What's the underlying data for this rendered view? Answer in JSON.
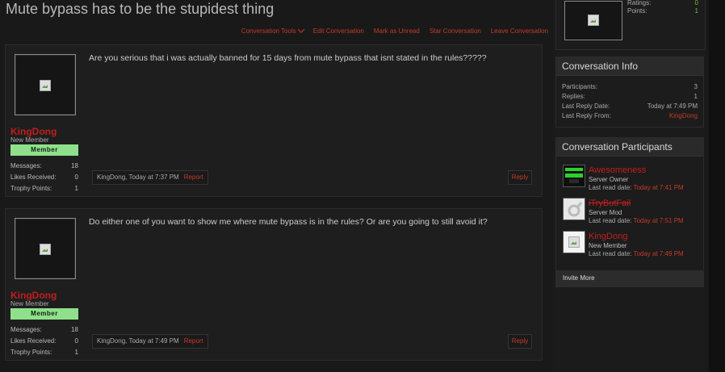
{
  "title": "Mute bypass has to be the stupidest thing",
  "tools": {
    "conversation_tools": "Conversation Tools",
    "edit": "Edit Conversation",
    "mark_unread": "Mark as Unread",
    "star": "Star Conversation",
    "leave": "Leave Conversation"
  },
  "messages": [
    {
      "username": "KingDong",
      "role": "New Member",
      "badge": "Member",
      "stats": [
        {
          "label": "Messages:",
          "value": "18"
        },
        {
          "label": "Likes Received:",
          "value": "0"
        },
        {
          "label": "Trophy Points:",
          "value": "1"
        }
      ],
      "text": "Are you serious that i was actually banned for 15 days from mute bypass that isnt stated in the rules?????",
      "meta": "KingDong, Today at 7:37 PM",
      "report": "Report",
      "reply": "Reply"
    },
    {
      "username": "KingDong",
      "role": "New Member",
      "badge": "Member",
      "stats": [
        {
          "label": "Messages:",
          "value": "18"
        },
        {
          "label": "Likes Received:",
          "value": "0"
        },
        {
          "label": "Trophy Points:",
          "value": "1"
        }
      ],
      "text": "Do either one of you want to show me where mute bypass is in the rules? Or are you going to still avoid it?",
      "meta": "KingDong, Today at 7:49 PM",
      "report": "Report",
      "reply": "Reply"
    }
  ],
  "top_card": {
    "ratings_label": "Ratings:",
    "ratings_value": "0",
    "points_label": "Points:",
    "points_value": "1"
  },
  "info": {
    "heading": "Conversation Info",
    "rows": [
      {
        "label": "Participants:",
        "value": "3"
      },
      {
        "label": "Replies:",
        "value": "1"
      },
      {
        "label": "Last Reply Date:",
        "value": "Today at 7:49 PM"
      },
      {
        "label": "Last Reply From:",
        "value": "KingDong"
      }
    ]
  },
  "participants": {
    "heading": "Conversation Participants",
    "list": [
      {
        "name": "Awesomeness",
        "role": "Server Owner",
        "read_label": "Last read date:",
        "read_time": "Today at 7:41 PM"
      },
      {
        "name": "iTryButFail",
        "role": "Server Mod",
        "read_label": "Last read date:",
        "read_time": "Today at 7:51 PM"
      },
      {
        "name": "KingDong",
        "role": "New Member",
        "read_label": "Last read date:",
        "read_time": "Today at 7:49 PM"
      }
    ],
    "invite": "Invite More"
  },
  "colors": {
    "accent_red": "#c23a2a",
    "username_red": "#c01e1e",
    "badge_green": "#8fe08a"
  }
}
